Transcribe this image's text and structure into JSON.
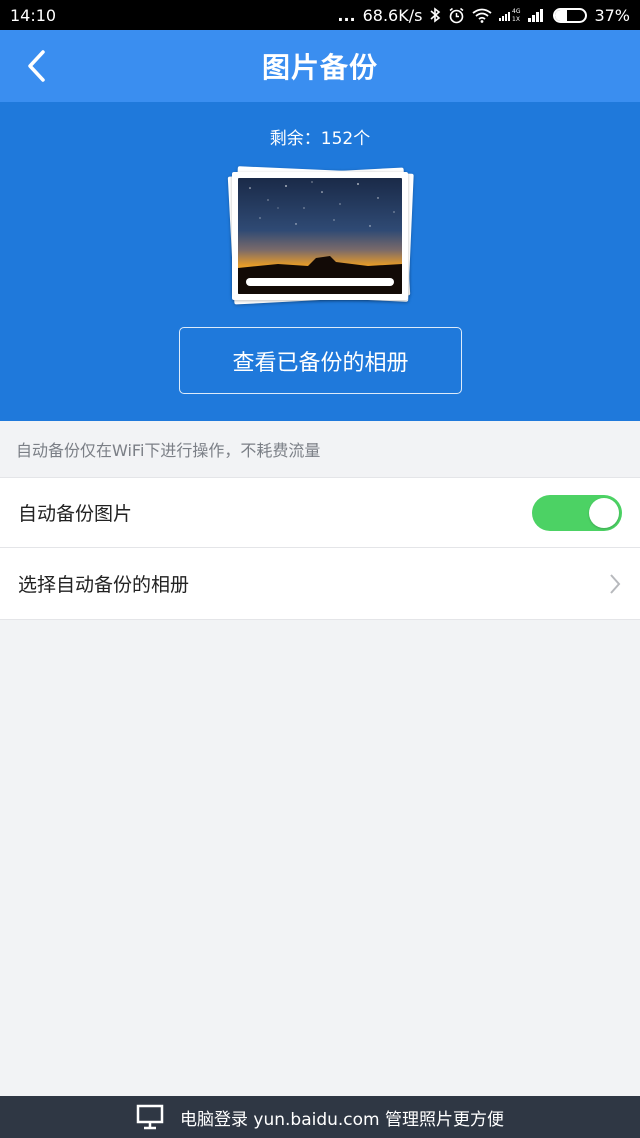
{
  "status_bar": {
    "time": "14:10",
    "dots": "...",
    "network_speed": "68.6K/s",
    "battery_text": "37%",
    "battery_level": 0.37,
    "icons": [
      "bluetooth-icon",
      "alarm-icon",
      "wifi-icon",
      "signal-4g-icon",
      "signal-icon",
      "battery-icon"
    ]
  },
  "nav": {
    "title": "图片备份",
    "back_icon": "chevron-left-icon"
  },
  "hero": {
    "remaining_text": "剩余：152个",
    "view_album_label": "查看已备份的相册"
  },
  "notice": "自动备份仅在WiFi下进行操作，不耗费流量",
  "settings": {
    "auto_backup_label": "自动备份图片",
    "auto_backup_enabled": true,
    "choose_album_label": "选择自动备份的相册"
  },
  "footer": {
    "text": "电脑登录 yun.baidu.com 管理照片更方便",
    "icon": "monitor-icon"
  },
  "colors": {
    "nav_bg": "#3a8ef0",
    "hero_bg": "#1f79db",
    "toggle_on": "#4cd264",
    "footer_bg": "#2f3744"
  }
}
